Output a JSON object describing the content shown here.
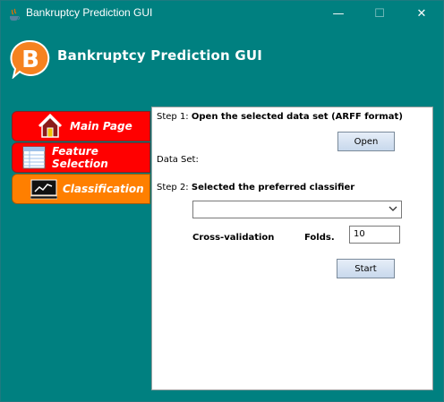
{
  "window": {
    "title": "Bankruptcy Prediction GUI",
    "controls": {
      "minimize": "—",
      "maximize": "☐",
      "close": "✕"
    }
  },
  "header": {
    "logo_letter": "B",
    "title": "Bankruptcy Prediction GUI"
  },
  "nav": {
    "items": [
      {
        "label": "Main Page",
        "icon": "house-icon"
      },
      {
        "label": "Feature Selection",
        "icon": "table-icon"
      },
      {
        "label": "Classification",
        "icon": "chart-monitor-icon",
        "active": true
      }
    ]
  },
  "panel": {
    "step1_prefix": "Step 1:",
    "step1_text": "Open the selected data set (ARFF format)",
    "open_button": "Open",
    "dataset_label": "Data Set:",
    "step2_prefix": "Step 2:",
    "step2_text": "Selected the preferred classifier",
    "classifier_value": "",
    "crossval_label": "Cross-validation",
    "folds_label": "Folds.",
    "folds_value": "10",
    "start_button": "Start"
  },
  "colors": {
    "background": "#008080",
    "nav_red": "#ff0000",
    "nav_orange": "#ff7f00",
    "logo_orange": "#f58220"
  }
}
